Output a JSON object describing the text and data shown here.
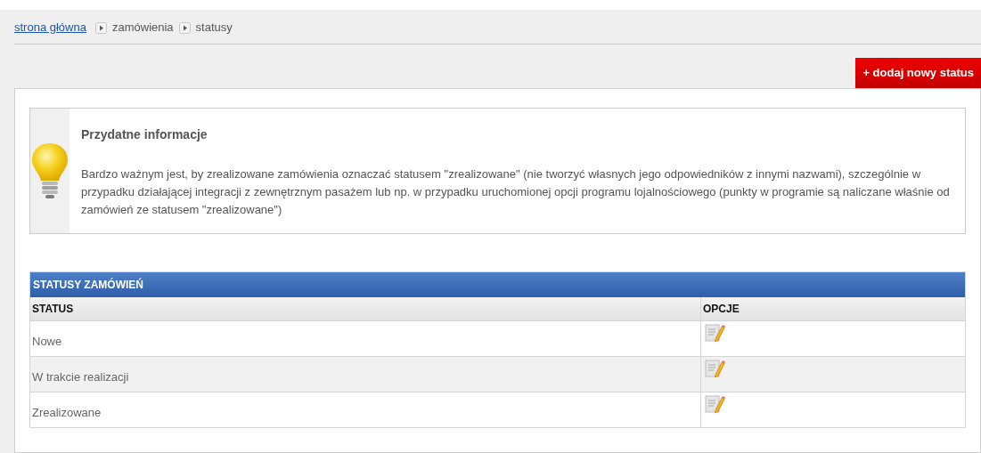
{
  "breadcrumb": [
    {
      "label": "strona główna",
      "kind": "link"
    },
    {
      "label": "zamówienia",
      "kind": "text"
    },
    {
      "label": "statusy",
      "kind": "text"
    }
  ],
  "add_button": "+ dodaj nowy status",
  "info": {
    "title": "Przydatne informacje",
    "text": "Bardzo ważnym jest, by zrealizowane zamówienia oznaczać statusem \"zrealizowane\" (nie tworzyć własnych jego odpowiedników z innymi nazwami), szczególnie w przypadku działającej integracji z zewnętrznym pasażem lub np. w przypadku uruchomionej opcji programu lojalnościowego (punkty w programie są naliczane właśnie od zamówień ze statusem \"zrealizowane\")"
  },
  "table": {
    "title": "STATUSY ZAMÓWIEŃ",
    "columns": [
      "STATUS",
      "OPCJE"
    ],
    "rows": [
      {
        "status": "Nowe"
      },
      {
        "status": "W trakcie realizacji"
      },
      {
        "status": "Zrealizowane"
      }
    ]
  }
}
